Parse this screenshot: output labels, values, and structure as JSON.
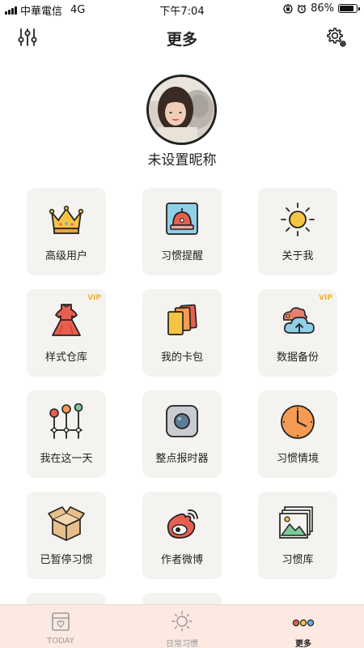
{
  "status_bar": {
    "carrier": "中華電信",
    "network": "4G",
    "time": "下午7:04",
    "battery": "86%",
    "battery_level": 0.86
  },
  "header": {
    "title": "更多",
    "filter_icon": "sliders-icon",
    "settings_icon": "gear-icon"
  },
  "profile": {
    "nickname": "未设置昵称"
  },
  "grid": {
    "items": [
      {
        "label": "高级用户",
        "icon": "crown-icon",
        "vip": ""
      },
      {
        "label": "习惯提醒",
        "icon": "alarm-bell-icon",
        "vip": ""
      },
      {
        "label": "关于我",
        "icon": "sun-icon",
        "vip": ""
      },
      {
        "label": "样式仓库",
        "icon": "dress-icon",
        "vip": "VIP"
      },
      {
        "label": "我的卡包",
        "icon": "cards-icon",
        "vip": ""
      },
      {
        "label": "数据备份",
        "icon": "cloud-upload-icon",
        "vip": "VIP"
      },
      {
        "label": "我在这一天",
        "icon": "timeline-pins-icon",
        "vip": ""
      },
      {
        "label": "整点报时器",
        "icon": "square-button-icon",
        "vip": ""
      },
      {
        "label": "习惯情境",
        "icon": "clock-icon",
        "vip": ""
      },
      {
        "label": "已暂停习惯",
        "icon": "box-icon",
        "vip": ""
      },
      {
        "label": "作者微博",
        "icon": "weibo-icon",
        "vip": ""
      },
      {
        "label": "习惯库",
        "icon": "photo-library-icon",
        "vip": ""
      }
    ]
  },
  "tabbar": {
    "tabs": [
      {
        "label": "TODAY",
        "icon": "today-calendar-icon",
        "active": false
      },
      {
        "label": "日常习惯",
        "icon": "sun-outline-icon",
        "active": false
      },
      {
        "label": "更多",
        "icon": "three-dots-icon",
        "active": true
      }
    ]
  },
  "colors": {
    "tile_bg": "#f4f3f0",
    "tabbar_bg": "#fbe9e2",
    "vip": "#f2b32c",
    "accent_orange": "#f49a52"
  }
}
